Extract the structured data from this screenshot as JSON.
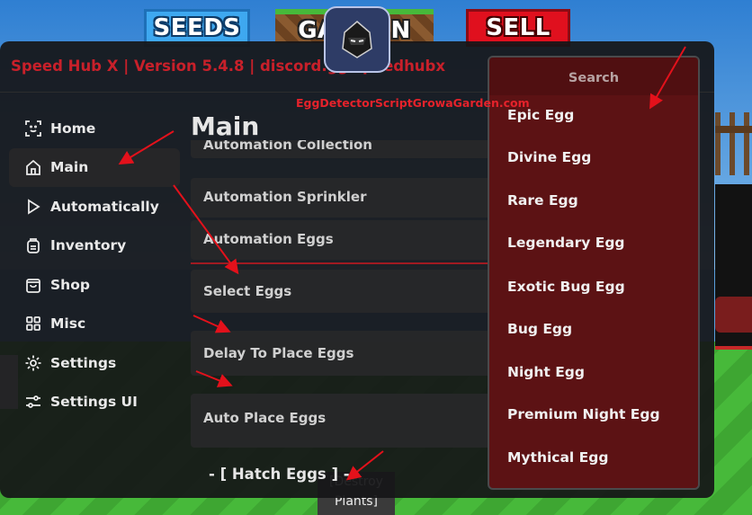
{
  "game": {
    "top_buttons": [
      "SEEDS",
      "GARDEN",
      "SELL"
    ],
    "bottom_label": "[Destroy\nPlants]"
  },
  "hub": {
    "title": "Speed Hub X | Version 5.4.8 | discord.gg/speedhubx",
    "main_title": "Main",
    "sidebar": [
      {
        "label": "Home",
        "icon": "home-face-icon"
      },
      {
        "label": "Main",
        "icon": "house-icon",
        "active": true
      },
      {
        "label": "Automatically",
        "icon": "play-icon"
      },
      {
        "label": "Inventory",
        "icon": "backpack-icon"
      },
      {
        "label": "Shop",
        "icon": "shopping-bag-icon"
      },
      {
        "label": "Misc",
        "icon": "grid-icon"
      },
      {
        "label": "Settings",
        "icon": "gear-icon"
      },
      {
        "label": "Settings UI",
        "icon": "sliders-icon"
      }
    ],
    "rows": [
      "Automation Collection",
      "Automation Sprinkler",
      "Automation Eggs",
      "Select Eggs",
      "Delay To Place Eggs",
      "Auto Place Eggs"
    ],
    "section_label": "- [ Hatch Eggs ] -"
  },
  "dropdown": {
    "search_placeholder": "Search",
    "options": [
      "Epic Egg",
      "Divine Egg",
      "Rare Egg",
      "Legendary Egg",
      "Exotic Bug Egg",
      "Bug Egg",
      "Night Egg",
      "Premium Night Egg",
      "Mythical Egg"
    ]
  },
  "watermark": "EggDetectorScriptGrowaGarden.com",
  "colors": {
    "accent_red": "#c8202a",
    "dropdown_bg": "#5c1214",
    "window_bg": "#161618"
  }
}
